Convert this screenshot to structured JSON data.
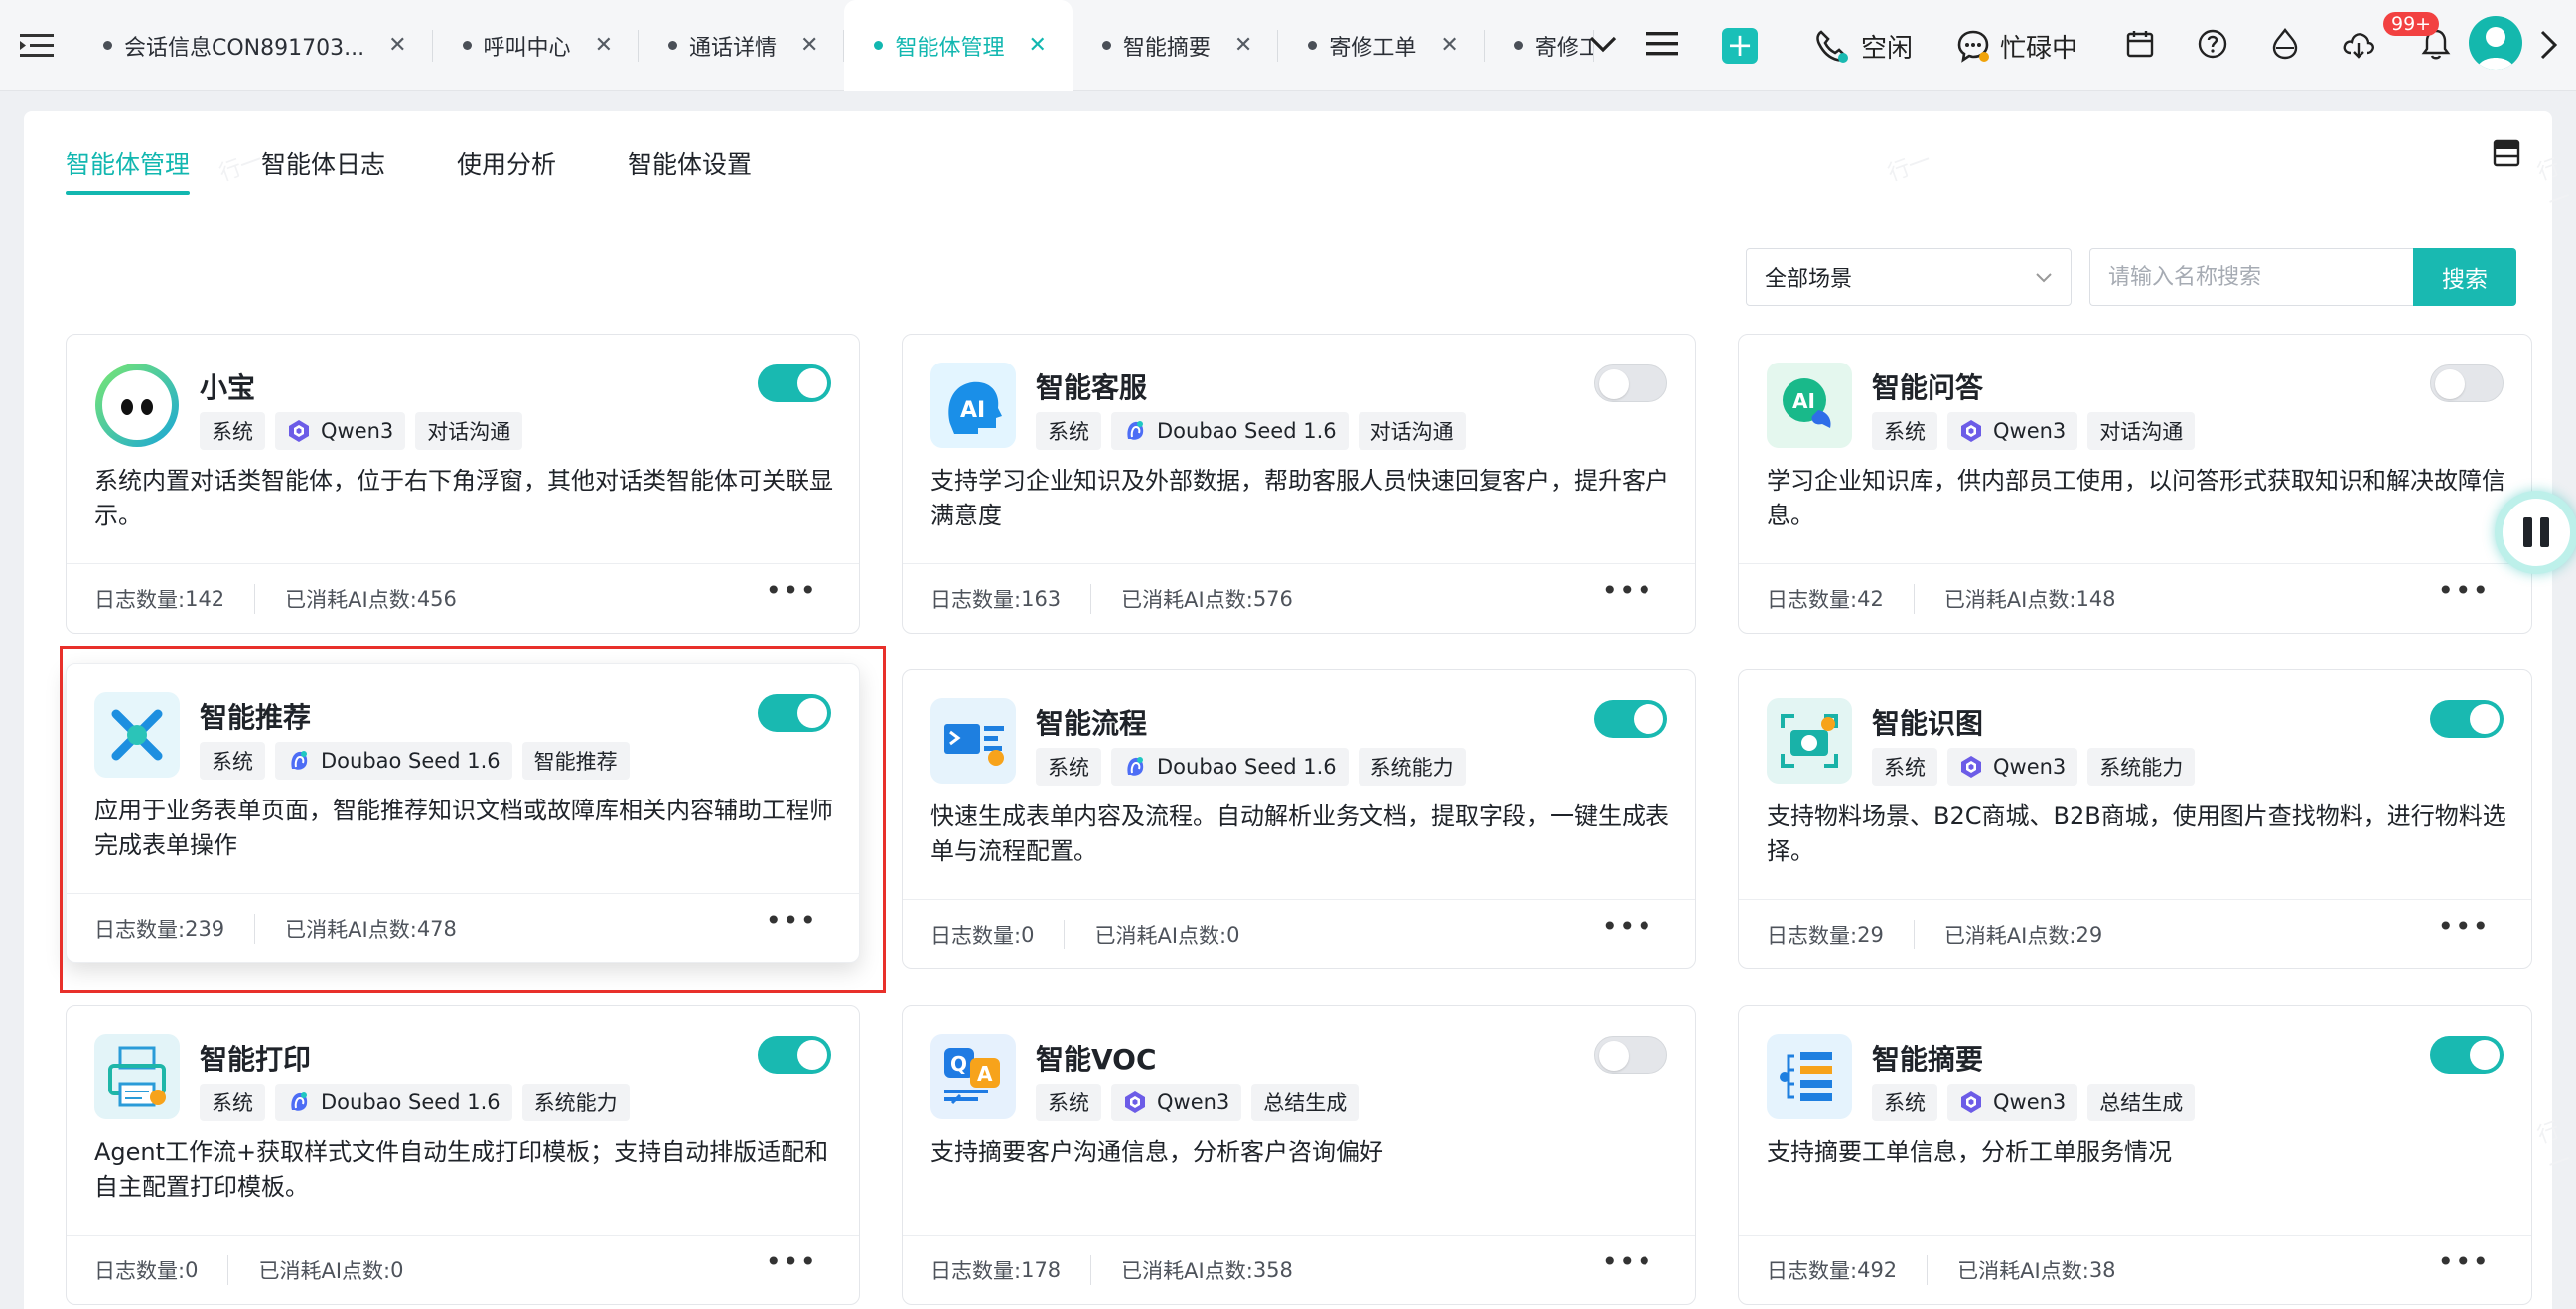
{
  "tabs": [
    {
      "label": "会话信息CON891703...",
      "active": false
    },
    {
      "label": "呼叫中心",
      "active": false
    },
    {
      "label": "通话详情",
      "active": false
    },
    {
      "label": "智能体管理",
      "active": true
    },
    {
      "label": "智能摘要",
      "active": false
    },
    {
      "label": "寄修工单",
      "active": false
    },
    {
      "label": "寄修工",
      "active": false
    }
  ],
  "status": {
    "idle_label": "空闲",
    "busy_label": "忙碌中",
    "notification_badge": "99+"
  },
  "subtabs": [
    "智能体管理",
    "智能体日志",
    "使用分析",
    "智能体设置"
  ],
  "filter": {
    "scene": "全部场景",
    "search_placeholder": "请输入名称搜索",
    "search_button": "搜索"
  },
  "log_label": "日志数量: ",
  "points_label": "已消耗AI点数: ",
  "tag_system": "系统",
  "cards": [
    {
      "name": "小宝",
      "enabled": true,
      "model": "Qwen3",
      "category": "对话沟通",
      "icon": "robot-face-icon",
      "description": "系统内置对话类智能体，位于右下角浮窗，其他对话类智能体可关联显示。",
      "logs": "142",
      "points": "456"
    },
    {
      "name": "智能客服",
      "enabled": false,
      "model": "Doubao Seed 1.6",
      "category": "对话沟通",
      "icon": "ai-head-icon",
      "description": "支持学习企业知识及外部数据，帮助客服人员快速回复客户，提升客户满意度",
      "logs": "163",
      "points": "576"
    },
    {
      "name": "智能问答",
      "enabled": false,
      "model": "Qwen3",
      "category": "对话沟通",
      "icon": "ai-chat-bubble-icon",
      "description": "学习企业知识库，供内部员工使用，以问答形式获取知识和解决故障信息。",
      "logs": "42",
      "points": "148"
    },
    {
      "name": "智能推荐",
      "enabled": true,
      "model": "Doubao Seed 1.6",
      "category": "智能推荐",
      "icon": "recommend-star-icon",
      "description": "应用于业务表单页面，智能推荐知识文档或故障库相关内容辅助工程师完成表单操作",
      "logs": "239",
      "points": "478"
    },
    {
      "name": "智能流程",
      "enabled": true,
      "model": "Doubao Seed 1.6",
      "category": "系统能力",
      "icon": "flow-terminal-icon",
      "description": "快速生成表单内容及流程。自动解析业务文档，提取字段，一键生成表单与流程配置。",
      "logs": "0",
      "points": "0"
    },
    {
      "name": "智能识图",
      "enabled": true,
      "model": "Qwen3",
      "category": "系统能力",
      "icon": "camera-scan-icon",
      "description": "支持物料场景、B2C商城、B2B商城，使用图片查找物料，进行物料选择。",
      "logs": "29",
      "points": "29"
    },
    {
      "name": "智能打印",
      "enabled": true,
      "model": "Doubao Seed 1.6",
      "category": "系统能力",
      "icon": "printer-icon",
      "description": "Agent工作流+获取样式文件自动生成打印模板；支持自动排版适配和自主配置打印模板。",
      "logs": "0",
      "points": "0"
    },
    {
      "name": "智能VOC",
      "enabled": false,
      "model": "Qwen3",
      "category": "总结生成",
      "icon": "qa-chat-icon",
      "description": "支持摘要客户沟通信息，分析客户咨询偏好",
      "logs": "178",
      "points": "358"
    },
    {
      "name": "智能摘要",
      "enabled": true,
      "model": "Qwen3",
      "category": "总结生成",
      "icon": "summary-list-icon",
      "description": "支持摘要工单信息，分析工单服务情况",
      "logs": "492",
      "points": "38"
    }
  ],
  "watermark_text": "行一",
  "colors": {
    "accent": "#19b9b1",
    "highlight": "#e8302a",
    "badge": "#f24141"
  }
}
